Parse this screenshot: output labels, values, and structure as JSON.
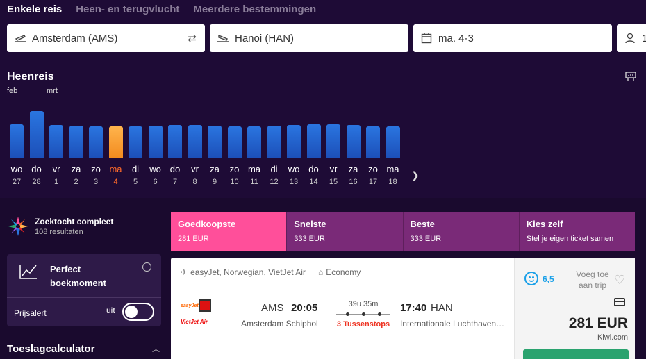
{
  "trip_tabs": [
    "Enkele reis",
    "Heen- en terugvlucht",
    "Meerdere bestemmingen"
  ],
  "search": {
    "from": "Amsterdam (AMS)",
    "to": "Hanoi (HAN)",
    "date": "ma. 4-3",
    "passengers": "1"
  },
  "chart": {
    "title": "Heenreis",
    "months": [
      "feb",
      "mrt"
    ],
    "days": [
      {
        "day": "wo",
        "num": "27",
        "level": 0.72
      },
      {
        "day": "do",
        "num": "28",
        "level": 1.0
      },
      {
        "day": "vr",
        "num": "1",
        "level": 0.7
      },
      {
        "day": "za",
        "num": "2",
        "level": 0.69
      },
      {
        "day": "zo",
        "num": "3",
        "level": 0.68
      },
      {
        "day": "ma",
        "num": "4",
        "level": 0.67
      },
      {
        "day": "di",
        "num": "5",
        "level": 0.68
      },
      {
        "day": "wo",
        "num": "6",
        "level": 0.69
      },
      {
        "day": "do",
        "num": "7",
        "level": 0.7
      },
      {
        "day": "vr",
        "num": "8",
        "level": 0.7
      },
      {
        "day": "za",
        "num": "9",
        "level": 0.69
      },
      {
        "day": "zo",
        "num": "10",
        "level": 0.68
      },
      {
        "day": "ma",
        "num": "11",
        "level": 0.67
      },
      {
        "day": "di",
        "num": "12",
        "level": 0.69
      },
      {
        "day": "wo",
        "num": "13",
        "level": 0.7
      },
      {
        "day": "do",
        "num": "14",
        "level": 0.72
      },
      {
        "day": "vr",
        "num": "15",
        "level": 0.72
      },
      {
        "day": "za",
        "num": "16",
        "level": 0.7
      },
      {
        "day": "zo",
        "num": "17",
        "level": 0.68
      },
      {
        "day": "ma",
        "num": "18",
        "level": 0.67
      }
    ],
    "selected_num": "4",
    "bar_color": "#2a75e0",
    "selected_color": "#f28b1e"
  },
  "sidebar": {
    "status_title": "Zoektocht compleet",
    "status_sub": "108 resultaten",
    "moment_title": "Perfect boekmoment",
    "alert_label": "Prijsalert",
    "toggle_label": "uit",
    "toeslag": "Toeslagcalculator"
  },
  "sort_tabs": [
    {
      "title": "Goedkoopste",
      "sub": "281 EUR"
    },
    {
      "title": "Snelste",
      "sub": "333 EUR"
    },
    {
      "title": "Beste",
      "sub": "333 EUR"
    },
    {
      "title": "Kies zelf",
      "sub": "Stel je eigen ticket samen"
    }
  ],
  "result": {
    "airlines": "easyJet, Norwegian, VietJet Air",
    "cabin": "Economy",
    "logo_easyjet": "easyJet",
    "logo_vietjet": "VietJet Air",
    "dep_code": "AMS",
    "dep_time": "20:05",
    "dep_name": "Amsterdam Schiphol",
    "duration": "39u 35m",
    "stops": "3 Tussenstops",
    "arr_time": "17:40",
    "arr_code": "HAN",
    "arr_name": "Internationale Luchthaven…",
    "score": "6,5",
    "save_label": "Voeg toe aan trip",
    "price": "281 EUR",
    "provider": "Kiwi.com"
  },
  "colors": {
    "background": "#1e0b36",
    "sort_active": "#ff4f9a",
    "sort_inactive": "#7a2a78",
    "book_button": "#2aa36f",
    "stops_red": "#e32222"
  }
}
